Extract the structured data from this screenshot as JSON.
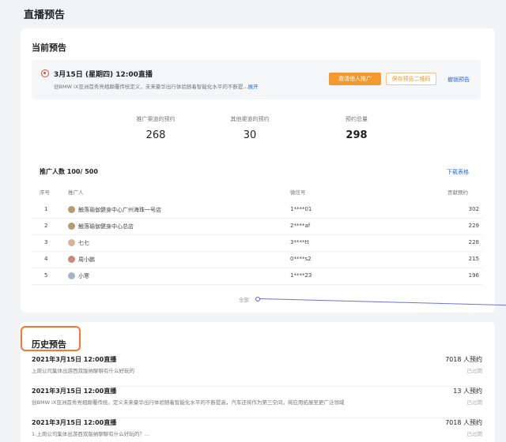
{
  "page": {
    "title": "直播预告"
  },
  "current": {
    "section_title": "当前预告",
    "preview": {
      "title": "3月15日 (星期四) 12:00直播",
      "description": "创BMW iX亚洲首秀亮相颠覆传统定义，未来豪华出行体验随着智能化水平的不断提...",
      "expand": "展开",
      "invite_button": "邀请他人推广",
      "qrcode_button": "保存预告二维码",
      "revoke_link": "撤销预告"
    },
    "stats": [
      {
        "label": "推广渠道的预约",
        "value": "268"
      },
      {
        "label": "其他渠道的预约",
        "value": "30"
      },
      {
        "label": "预约总量",
        "value": "298"
      }
    ],
    "promoters": {
      "header": "推广人数 100/ 500",
      "download": "下载表格",
      "columns": [
        "序号",
        "推广人",
        "微信号",
        "贡献预约"
      ],
      "rows": [
        {
          "index": "1",
          "name": "触落瑜伽健身中心广州海珠一号店",
          "wechat": "1****01",
          "count": "302"
        },
        {
          "index": "2",
          "name": "触落瑜伽健身中心总店",
          "wechat": "2****af",
          "count": "229"
        },
        {
          "index": "3",
          "name": "七七",
          "wechat": "3****tt",
          "count": "228"
        },
        {
          "index": "4",
          "name": "周小鹏",
          "wechat": "0****s2",
          "count": "215"
        },
        {
          "index": "5",
          "name": "小寒",
          "wechat": "1****23",
          "count": "196"
        }
      ],
      "more": "全部"
    }
  },
  "history": {
    "section_title": "历史预告",
    "items": [
      {
        "title": "2021年3月15日 12:00直播",
        "desc": "上周公司集体出游西双版纳聊聊有什么好玩的",
        "count": "7018 人预约",
        "status": "已过期"
      },
      {
        "title": "2021年3月15日 12:00直播",
        "desc": "创BMW iX亚洲首秀亮相颠覆传统。定义未来豪华出行体验随着智能化水平的不断提高，汽车还将作为第三空间，将应用拓展至更广泛领域",
        "count": "13 人预约",
        "status": "已过期"
      },
      {
        "title": "2021年3月15日 12:00直播",
        "desc": "1.上周公司集体出游西双版纳聊聊有什么好玩的？...",
        "count": "7018 人预约",
        "status": "已过期"
      }
    ]
  }
}
